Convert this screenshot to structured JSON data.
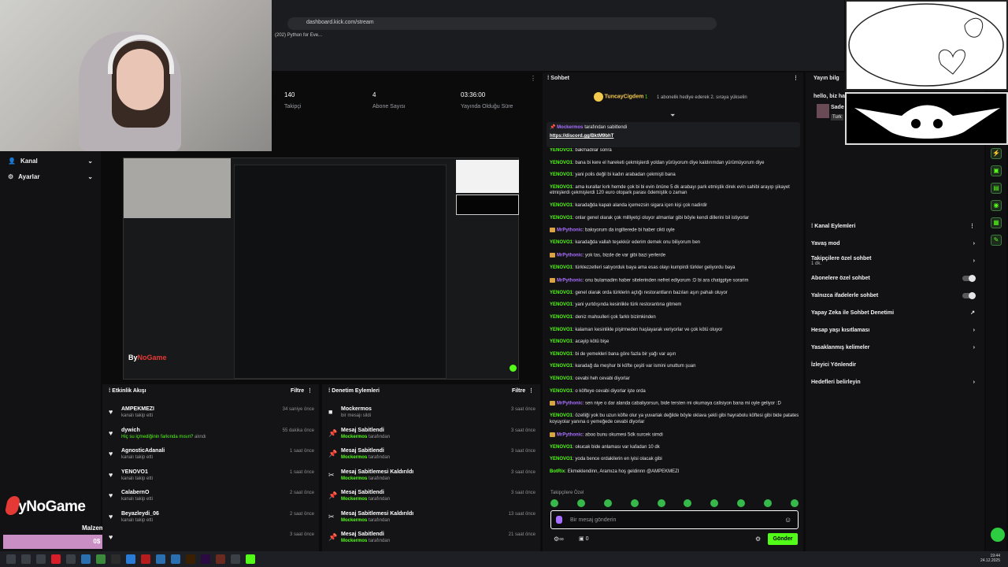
{
  "browser": {
    "url": "dashboard.kick.com/stream",
    "bookmark": "(202) Python for Eve..."
  },
  "sidebar": {
    "items": [
      {
        "label": "Kanal",
        "icon": "user-icon"
      },
      {
        "label": "Ayarlar",
        "icon": "gear-icon"
      }
    ]
  },
  "brand": {
    "name_a": "By",
    "name_b": "NoGame"
  },
  "goal": {
    "title": "Malzeme ihtiyacı",
    "progress_label": "0$ (0.00%)",
    "progress": 0.0
  },
  "stats": [
    {
      "value": "140",
      "label": "Takipçi"
    },
    {
      "value": "4",
      "label": "Abone Sayısı"
    },
    {
      "value": "03:36:00",
      "label": "Yayında Olduğu Süre"
    }
  ],
  "activity": {
    "title": "Etkinlik Akışı",
    "filter": "Filtre",
    "items": [
      {
        "name": "AMPEKMEZI",
        "sub": "kanalı takip etti",
        "time": "34 saniye önce"
      },
      {
        "name": "dywich",
        "sub_highlight": "Hiç su içmediğinin farkında mısın?",
        "sub_rest": " alındı",
        "time": "55 dakika önce"
      },
      {
        "name": "AgnosticAdanali",
        "sub": "kanalı takip etti",
        "time": "1 saat önce"
      },
      {
        "name": "YENOVO1",
        "sub": "kanalı takip etti",
        "time": "1 saat önce"
      },
      {
        "name": "CalabernO",
        "sub": "kanalı takip etti",
        "time": "2 saat önce"
      },
      {
        "name": "Beyazleydi_06",
        "sub": "kanalı takip etti",
        "time": "2 saat önce"
      },
      {
        "name": "",
        "sub": "",
        "time": "3 saat önce"
      }
    ]
  },
  "moderation": {
    "title": "Denetim Eylemleri",
    "filter": "Filtre",
    "items": [
      {
        "title": "Mockermos",
        "sub": "bir mesajı sildi",
        "user": "",
        "time": "3 saat önce",
        "icon": "user-icon"
      },
      {
        "title": "Mesaj Sabitlendi",
        "user": "Mockermos",
        "sub": " tarafından",
        "time": "3 saat önce",
        "icon": "pin-icon"
      },
      {
        "title": "Mesaj Sabitlendi",
        "user": "Mockermos",
        "sub": " tarafından",
        "time": "3 saat önce",
        "icon": "pin-icon"
      },
      {
        "title": "Mesaj Sabitlemesi Kaldırıldı",
        "user": "Mockermos",
        "sub": " tarafından",
        "time": "3 saat önce",
        "icon": "unpin-icon"
      },
      {
        "title": "Mesaj Sabitlendi",
        "user": "Mockermos",
        "sub": " tarafından",
        "time": "3 saat önce",
        "icon": "pin-icon"
      },
      {
        "title": "Mesaj Sabitlemesi Kaldırıldı",
        "user": "Mockermos",
        "sub": " tarafından",
        "time": "13 saat önce",
        "icon": "unpin-icon"
      },
      {
        "title": "Mesaj Sabitlendi",
        "user": "Mockermos",
        "sub": " tarafından",
        "time": "21 saat önce",
        "icon": "pin-icon"
      }
    ]
  },
  "chat": {
    "title": "Sohbet",
    "gift": {
      "user": "TuncayCigdem",
      "count": "1",
      "text": "1 abonelik hediye ederek 2. sıraya yükselin"
    },
    "pinned": {
      "user": "Mockermos",
      "text": "tarafından sabitlendi",
      "link": "https://discord.gg/BktM9bhT"
    },
    "messages": [
      {
        "u": "YENOVO1",
        "p": false,
        "t": "bakmadılar sonra"
      },
      {
        "u": "YENOVO1",
        "p": false,
        "t": "bana bi kere el hareketi çekmişlerdi yoldan yürüyorum diye kaldırımdan yürümüyorum diye"
      },
      {
        "u": "YENOVO1",
        "p": false,
        "t": "yani polis değil bi kadın arabadan çekmişti bana"
      },
      {
        "u": "YENOVO1",
        "p": false,
        "t": "ama kurallar kırk hemde çok bi bi evin önüne 5 dk arabayı park etmiştik direk evin sahibi arayıp şikayet etmişlerdi çekmişlerdi 120 euro otopark parası ödemiştik o zaman"
      },
      {
        "u": "YENOVO1",
        "p": false,
        "t": "karadağda kapalı alanda içemezsin sigara içen kişi çok nadirdir"
      },
      {
        "u": "YENOVO1",
        "p": false,
        "t": "onlar genel olarak çok milliyetçi oluyor almanlar gibi böyle kendi dillerini bil istiyorlar"
      },
      {
        "u": "MrPythonic",
        "p": true,
        "t": "bakıyorum da ingilterede bi haber cikti oyle"
      },
      {
        "u": "YENOVO1",
        "p": false,
        "t": "karadağda vallah teşekkür ederim demek onu biliyorum ben"
      },
      {
        "u": "MrPythonic",
        "p": true,
        "t": "yok tas, bizde de var gibi bazi yerlerde"
      },
      {
        "u": "YENOVO1",
        "p": false,
        "t": "türklezzetleri satıyorduk baya ama esas olayı kumpirdi türkler geliyordu baya"
      },
      {
        "u": "MrPythonic",
        "p": true,
        "t": "onu bulamadim haber sitelerinden nefret ediyorum :D bi ara chatgptye sorarim"
      },
      {
        "u": "YENOVO1",
        "p": false,
        "t": "genel olarak orda türklerin açtığı restorantların bazıları aşırı pahalı oluyor"
      },
      {
        "u": "YENOVO1",
        "p": false,
        "t": "yani yurtdışında kesinlikle türk restorantına gitmem"
      },
      {
        "u": "YENOVO1",
        "p": false,
        "t": "deniz mahsulleri çok farklı bizimkinden"
      },
      {
        "u": "YENOVO1",
        "p": false,
        "t": "kalamarı kesinlikle pişirmeden haşlayarak veriyorlar ve çok kötü oluyor"
      },
      {
        "u": "YENOVO1",
        "p": false,
        "t": "acayip kötü bişe"
      },
      {
        "u": "YENOVO1",
        "p": false,
        "t": "bi de yemekleri bana göre fazla bir yağı var aşırı"
      },
      {
        "u": "YENOVO1",
        "p": false,
        "t": "karadağ da meşhur bi köfte çeşiti var ismini unuttum şuan"
      },
      {
        "u": "YENOVO1",
        "p": false,
        "t": "cevabi heh cevabi diyorlar"
      },
      {
        "u": "YENOVO1",
        "p": false,
        "t": "o köfteye cevabi diyorlar işte orda"
      },
      {
        "u": "MrPythonic",
        "p": true,
        "t": "sen niye o dar alanda cabaliyorsun, bide tersten mi okumaya calisiyon bana mi oyle geliyor :D"
      },
      {
        "u": "YENOVO1",
        "p": false,
        "t": "özelliği yok bu uzun köfte olur ya yuvarlak değilde böyle oklava şekli gibi hayrabolu köftesi gibi bide patates koyuyolar yanına o yemeğede cevabi diyorlar"
      },
      {
        "u": "MrPythonic",
        "p": true,
        "t": "aboo bunu okumesi 5dk surcek simdi"
      },
      {
        "u": "YENOVO1",
        "p": false,
        "t": "okucak bide anlaması var kafadan 10 dk"
      },
      {
        "u": "YENOVO1",
        "p": false,
        "t": "yoda bence ordakilerin en iyisi olacak gibi"
      },
      {
        "u": "BotRix",
        "p": false,
        "t": "Ekmeklendinn, Aramıza hoş geldinnn @AMPEKMEZI"
      }
    ],
    "followers_only": "Takipçilere Özel",
    "input_placeholder": "Bir mesaj gönderin",
    "count": "0",
    "send_label": "Gönder"
  },
  "channel_actions": {
    "header": "Yayın bilg",
    "title": "Kanal Eylemleri",
    "items": [
      {
        "label": "Yavaş mod",
        "control": "chevron"
      },
      {
        "label": "Takipçilere özel sohbet",
        "sub": "1 dk.",
        "control": "chevron"
      },
      {
        "label": "Abonelere özel sohbet",
        "control": "toggle"
      },
      {
        "label": "Yalnızca ifadelerle sohbet",
        "control": "toggle"
      },
      {
        "label": "Yapay Zeka ile Sohbet Denetimi",
        "control": "external"
      },
      {
        "label": "Hesap yaşı kısıtlaması",
        "control": "chevron"
      },
      {
        "label": "Yasaklanmış kelimeler",
        "control": "chevron"
      },
      {
        "label": "İzleyici Yönlendir",
        "control": "none"
      },
      {
        "label": "Hedefleri belirleyin",
        "control": "chevron"
      }
    ]
  },
  "stream_info": {
    "greeting": "hello, biz ha",
    "name": "Sade",
    "tag": "Turk"
  },
  "taskbar": {
    "time": "19:44",
    "date": "24.12.2025"
  },
  "colors": {
    "accent": "#53fc18",
    "purple": "#a970ff"
  }
}
